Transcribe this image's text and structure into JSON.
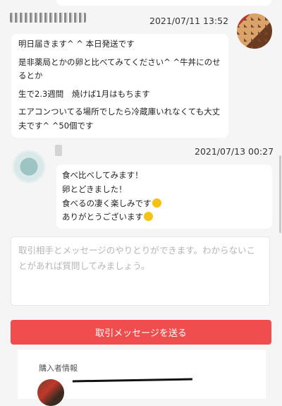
{
  "thread": {
    "seller_message": {
      "timestamp": "2021/07/11 13:52",
      "lines": [
        "明日届きます^ ^ 本日発送です",
        "是非薬局とかの卵と比べてみてください^ ^牛丼にのせるとか",
        "生で2.3週間　焼けば1月はもちます",
        "エアコンついてる場所でしたら冷蔵庫いれなくても大丈夫です^ ^50個です"
      ]
    },
    "buyer_message": {
      "timestamp": "2021/07/13 00:27",
      "lines": [
        "食べ比べしてみます！",
        "卵とどきました！",
        "食べるの凄く楽しみです",
        "ありがとうございます"
      ],
      "emoji": "smiling-face-emoji"
    }
  },
  "compose": {
    "placeholder": "取引相手とメッセージのやりとりができます。わからないことがあれば質問してみましょう。",
    "send_label": "取引メッセージを送る"
  },
  "buyer_info": {
    "title": "購入者情報"
  },
  "colors": {
    "accent": "#f04e4e",
    "background": "#f5f5f5",
    "bubble": "#ffffff"
  }
}
